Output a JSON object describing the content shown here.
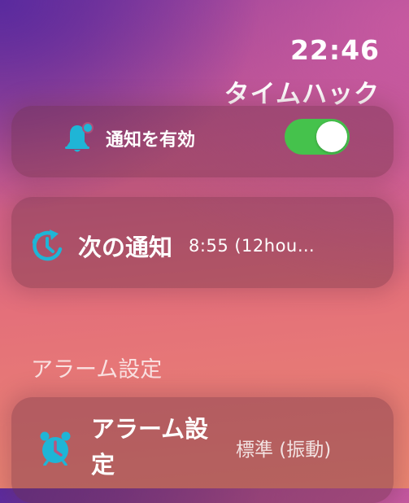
{
  "status": {
    "time": "22:46"
  },
  "app": {
    "title": "タイムハック"
  },
  "notifications": {
    "enable_label": "通知を有効",
    "enabled": true
  },
  "next_notification": {
    "label": "次の通知",
    "value": "8:55 (12hou…"
  },
  "alarm_section": {
    "header": "アラーム設定",
    "row_label": "アラーム設定",
    "row_value": "標準 (振動)"
  },
  "colors": {
    "accent": "#1fb5d6",
    "toggle_on": "#45c24c"
  },
  "icons": {
    "notify": "bell-icon",
    "next": "clock-history-icon",
    "alarm": "alarm-clock-icon"
  }
}
